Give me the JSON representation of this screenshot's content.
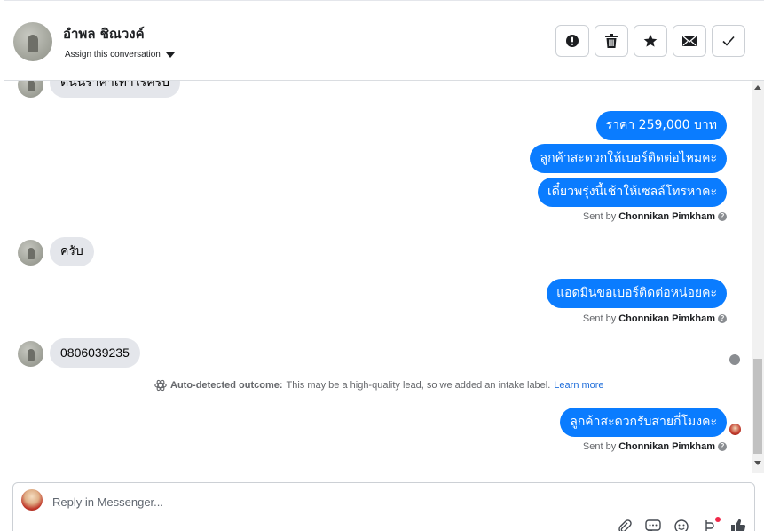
{
  "header": {
    "contact_name": "อำพล ชิณวงค์",
    "assign_label": "Assign this conversation",
    "actions": [
      {
        "name": "mark-as-spam-button",
        "icon": "exclamation-circle-icon"
      },
      {
        "name": "delete-button",
        "icon": "trash-icon"
      },
      {
        "name": "follow-up-button",
        "icon": "star-icon"
      },
      {
        "name": "mark-unread-button",
        "icon": "envelope-icon"
      },
      {
        "name": "mark-done-button",
        "icon": "checkmark-icon"
      }
    ]
  },
  "messages": {
    "partial_in": "ตีนนราคาเท่าไรครับ",
    "out_1": "ราคา 259,000 บาท",
    "out_2": "ลูกค้าสะดวกให้เบอร์ติดต่อไหมคะ",
    "out_3": "เดี๋ยวพรุ่งนี้เช้าให้เซลล์โทรหาคะ",
    "in_1": "ครับ",
    "out_4": "แอดมินขอเบอร์ติดต่อหน่อยคะ",
    "in_2": "0806039235",
    "out_5": "ลูกค้าสะดวกรับสายกี่โมงคะ"
  },
  "sent_by": {
    "prefix": "Sent by",
    "name": "Chonnikan Pimkham",
    "help": "?"
  },
  "auto_outcome": {
    "label": "Auto-detected outcome:",
    "text": "This may be a high-quality lead, so we added an intake label.",
    "link": "Learn more"
  },
  "composer": {
    "placeholder": "Reply in Messenger...",
    "tools": [
      "paperclip-icon",
      "saved-reply-icon",
      "emoji-icon",
      "automation-icon",
      "thumbs-up-icon"
    ]
  },
  "colors": {
    "outgoing_bubble": "#0a7cff",
    "incoming_bubble": "#e4e6eb",
    "link": "#216fdb"
  }
}
